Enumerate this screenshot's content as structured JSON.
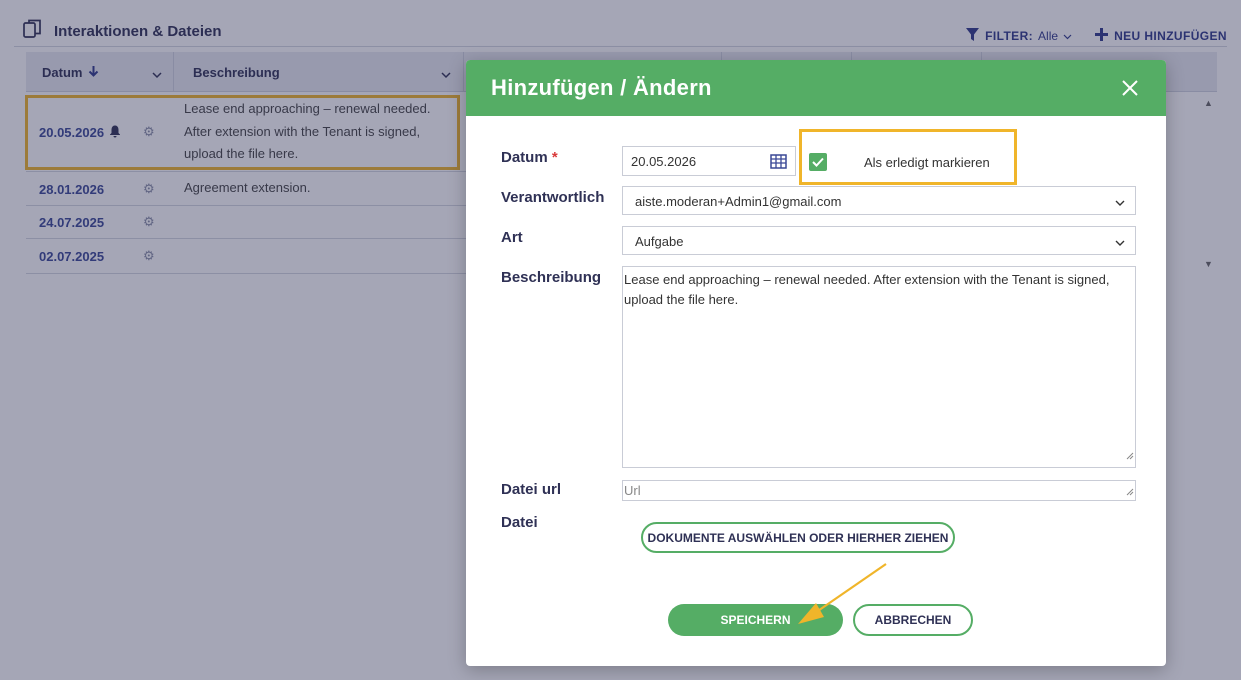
{
  "section": {
    "title": "Interaktionen & Dateien",
    "filter_label": "FILTER:",
    "filter_value": "Alle",
    "add_label": "NEU HINZUFÜGEN"
  },
  "grid": {
    "columns": [
      "Datum",
      "Beschreibung"
    ],
    "rows": [
      {
        "date": "20.05.2026",
        "description": "Lease end approaching – renewal needed. After extension with the Tenant is signed, upload the file here."
      },
      {
        "date": "28.01.2026",
        "description": "Agreement extension."
      },
      {
        "date": "24.07.2025",
        "description": ""
      },
      {
        "date": "02.07.2025",
        "description": ""
      }
    ]
  },
  "modal": {
    "title": "Hinzufügen / Ändern",
    "labels": {
      "datum": "Datum",
      "required_mark": "*",
      "verantwortlich": "Verantwortlich",
      "art": "Art",
      "beschreibung": "Beschreibung",
      "datei_url": "Datei url",
      "datei": "Datei"
    },
    "date_value": "20.05.2026",
    "done_label": "Als erledigt markieren",
    "done_checked": true,
    "responsible_value": "aiste.moderan+Admin1@gmail.com",
    "type_value": "Aufgabe",
    "description_value": "Lease end approaching – renewal needed. After extension with the Tenant is signed, upload the file here.",
    "url_placeholder": "Url",
    "upload_label": "DOKUMENTE AUSWÄHLEN ODER HIERHER ZIEHEN",
    "save_label": "SPEICHERN",
    "cancel_label": "ABBRECHEN"
  },
  "colors": {
    "accent_green": "#55ad65",
    "highlight_orange": "#f0b52a",
    "navy": "#2f3155"
  }
}
